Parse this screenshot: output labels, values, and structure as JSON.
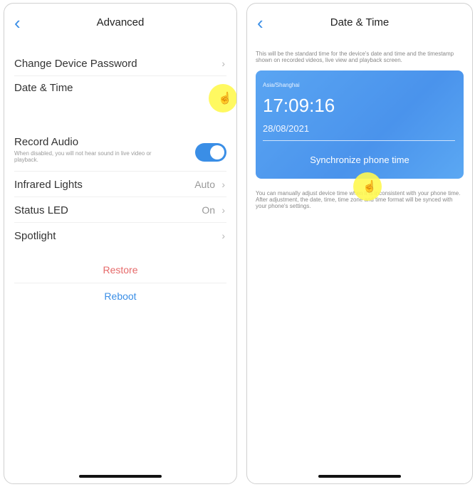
{
  "left_screen": {
    "nav": {
      "title": "Advanced",
      "back_glyph": "‹"
    },
    "rows": {
      "password": {
        "label": "Change Device Password",
        "chevron": "›"
      },
      "datetime": {
        "label": "Date & Time"
      },
      "record": {
        "label": "Record Audio",
        "description": "When disabled, you will not hear sound in live video or playback.",
        "toggle_on": true
      },
      "infrared": {
        "label": "Infrared Lights",
        "value": "Auto",
        "chevron": "›"
      },
      "led": {
        "label": "Status LED",
        "value": "On",
        "chevron": "›"
      },
      "spotlight": {
        "label": "Spotlight",
        "chevron": "›"
      }
    },
    "actions": {
      "restore": "Restore",
      "reboot": "Reboot"
    }
  },
  "right_screen": {
    "nav": {
      "title": "Date & Time",
      "back_glyph": "‹"
    },
    "info_top": "This will be the standard time for the device's date and time and the timestamp shown on recorded videos, live view and playback screen.",
    "card": {
      "timezone": "Asia/Shanghai",
      "time": "17:09:16",
      "date": "28/08/2021",
      "sync_label": "Synchronize phone time"
    },
    "info_bottom": "You can manually adjust device time when it is inconsistent with your phone time. After adjustment, the date, time, time zone and time format will be synced with your phone's settings."
  },
  "tap_indicator": {
    "icon": "pointing-hand-icon",
    "glyph": "☝",
    "color": "#fff850"
  },
  "colors": {
    "accent": "#3a8ee6",
    "destructive": "#e66a6a",
    "card_blue": "#4a93ec"
  }
}
